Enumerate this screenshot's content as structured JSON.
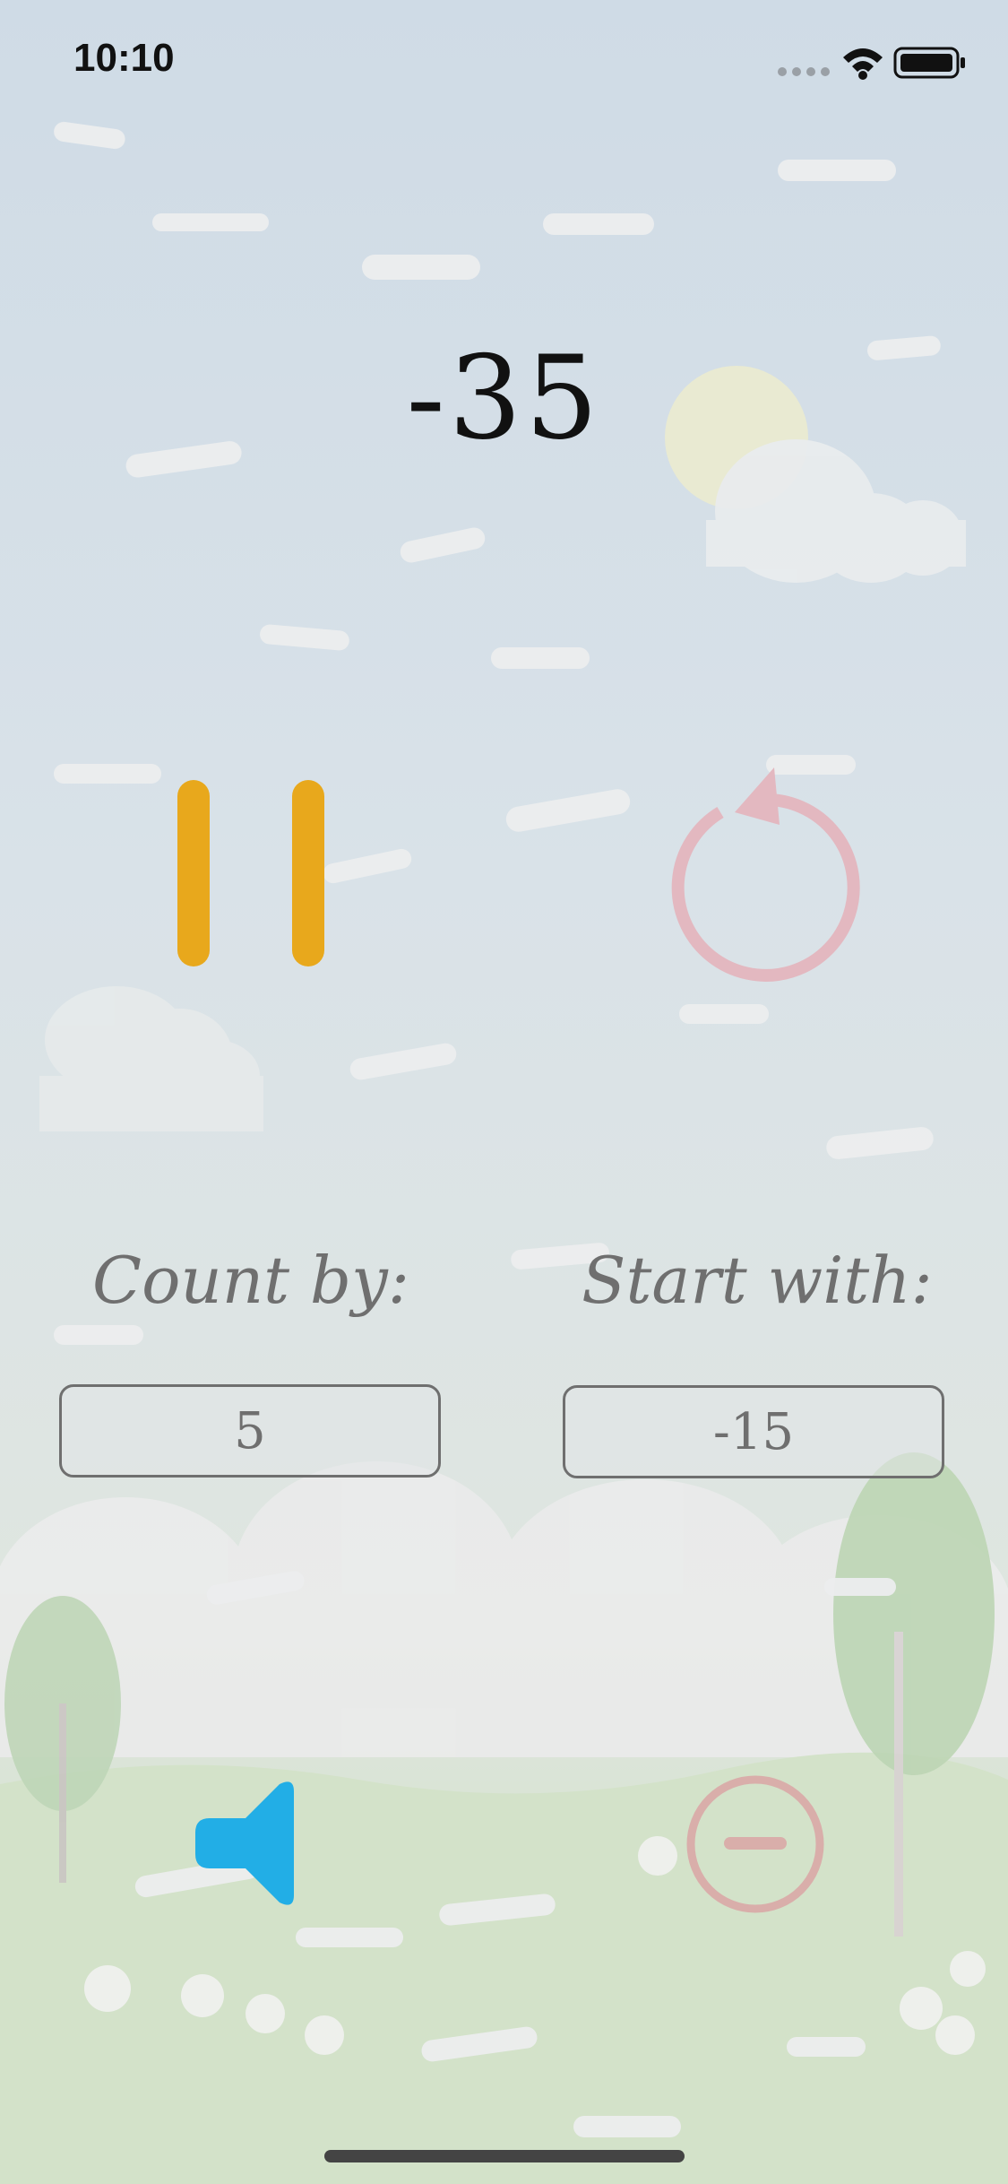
{
  "status_bar": {
    "time": "10:10"
  },
  "counter": {
    "value": "-35"
  },
  "controls": {
    "pause_icon": "pause-icon",
    "reset_icon": "restart-arrow-icon"
  },
  "settings": {
    "count_by_label": "Count by:",
    "count_by_value": "5",
    "start_with_label": "Start with:",
    "start_with_value": "-15"
  },
  "bottom": {
    "sound_icon": "speaker-icon",
    "minus_icon": "minus-circle-icon"
  },
  "colors": {
    "pause": "#e8a81c",
    "reset": "#e3b8c0",
    "sound": "#22aee6",
    "minus": "#d9aeaa"
  }
}
